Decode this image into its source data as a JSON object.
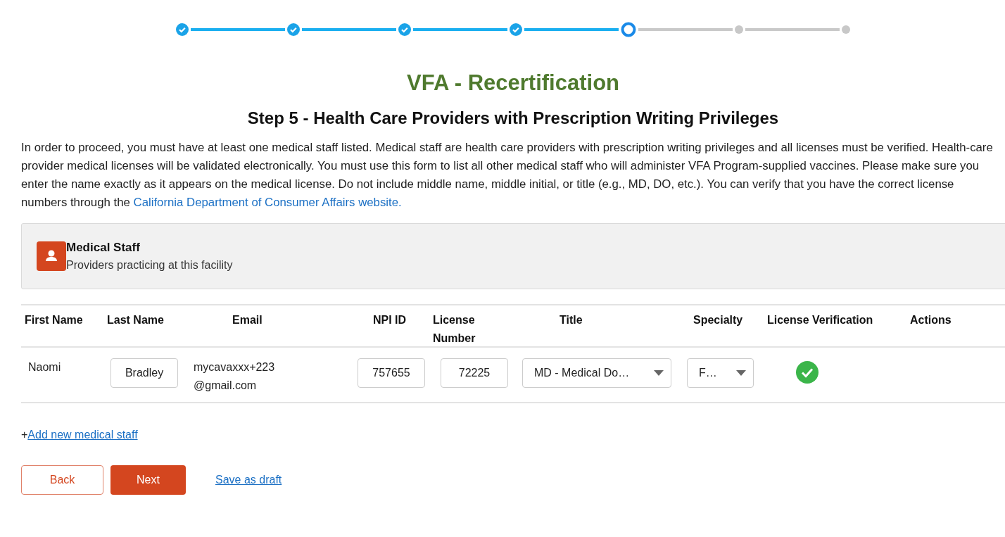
{
  "stepper": [
    {
      "completed": true,
      "current": false
    },
    {
      "completed": true,
      "current": false
    },
    {
      "completed": true,
      "current": false
    },
    {
      "completed": true,
      "current": false
    },
    {
      "completed": false,
      "current": true
    },
    {
      "completed": false,
      "current": false
    },
    {
      "completed": false,
      "current": false
    }
  ],
  "title": "VFA - Recertification",
  "subtitle": "Step 5 - Health Care Providers with Prescription Writing Privileges",
  "intro": {
    "text": "In order to proceed, you must have at least one medical staff listed. Medical staff are health care providers with prescription writing privileges and all licenses must be verified. Health-care provider medical licenses will be validated electronically. You must use this form to list all other medical staff who will administer VFA Program-supplied vaccines. Please make sure you enter the name exactly as it appears on the medical license. Do not include middle name, middle initial, or title (e.g., MD, DO, etc.). You can verify that you have the correct license numbers through the ",
    "link": "California Department of Consumer Affairs website."
  },
  "section": {
    "title": "Medical Staff",
    "subtitle": "Providers practicing at this facility"
  },
  "table": {
    "columns": [
      "First Name",
      "Last Name",
      "Email",
      "NPI ID",
      "License Number",
      "Title",
      "Specialty",
      "License Verification",
      "Actions"
    ],
    "rows": [
      {
        "first_name": "Naomi",
        "last_name": "Bradley",
        "email_lines": [
          "mycavaxxx+223",
          "@gmail.com"
        ],
        "npi_id": "757655",
        "license_number": "72225",
        "title": "MD - Medical Do…",
        "specialty": "F…",
        "verified": true
      }
    ]
  },
  "add_prefix": "+",
  "add_link": "Add new medical staff",
  "buttons": {
    "back": "Back",
    "next": "Next",
    "save_draft": "Save as draft"
  }
}
